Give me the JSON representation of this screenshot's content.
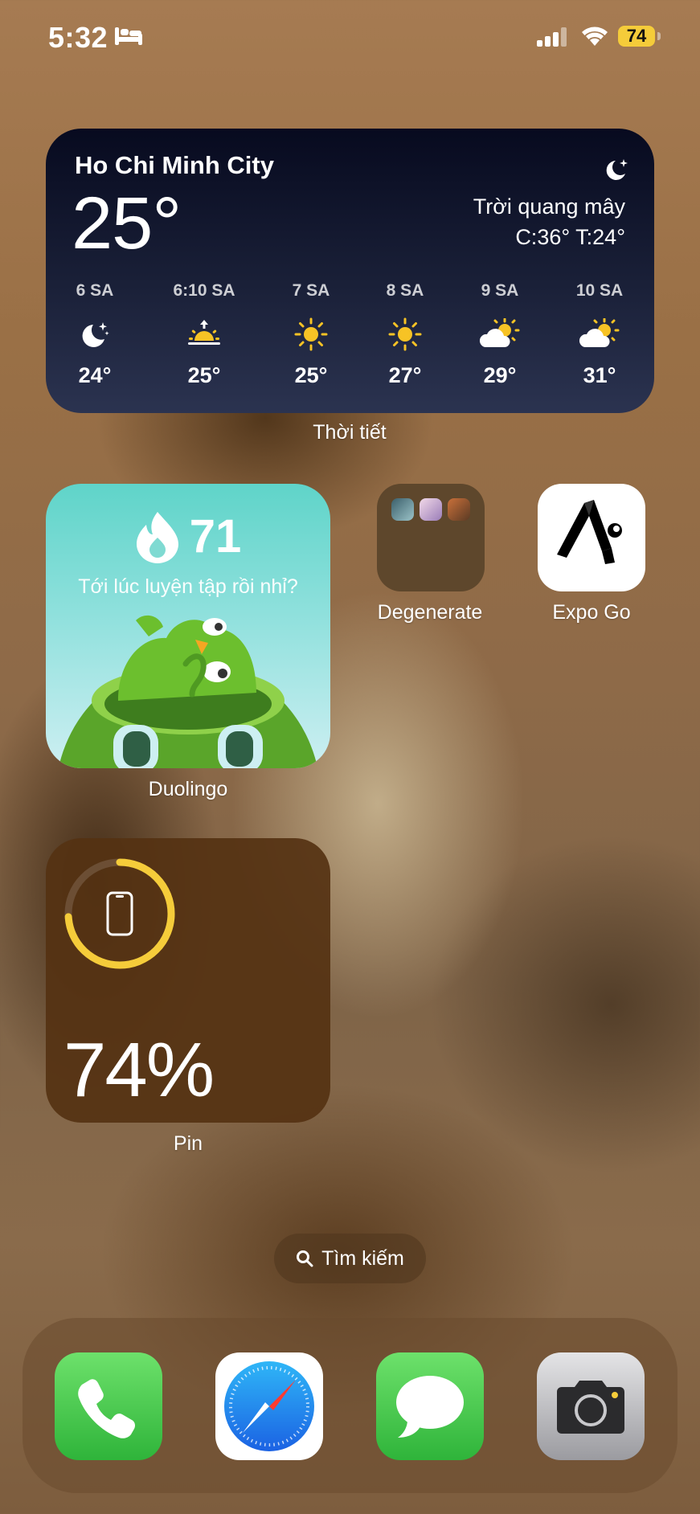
{
  "status_bar": {
    "time": "5:32",
    "battery_level": "74",
    "icons": [
      "bed-icon",
      "cellular-signal-icon",
      "wifi-icon",
      "battery-icon"
    ]
  },
  "weather_widget": {
    "city": "Ho Chi Minh City",
    "temperature": "25°",
    "condition": "Trời quang mây",
    "high_low": "C:36° T:24°",
    "condition_icon": "moon-stars-icon",
    "hours": [
      {
        "time": "6 SA",
        "icon": "moon-stars-icon",
        "temp": "24°"
      },
      {
        "time": "6:10 SA",
        "icon": "sunrise-icon",
        "temp": "25°"
      },
      {
        "time": "7 SA",
        "icon": "sun-icon",
        "temp": "25°"
      },
      {
        "time": "8 SA",
        "icon": "sun-icon",
        "temp": "27°"
      },
      {
        "time": "9 SA",
        "icon": "partly-cloudy-icon",
        "temp": "29°"
      },
      {
        "time": "10 SA",
        "icon": "partly-cloudy-icon",
        "temp": "31°"
      }
    ],
    "label": "Thời tiết"
  },
  "duolingo_widget": {
    "streak": "71",
    "message": "Tới lúc luyện tập rồi nhỉ?",
    "label": "Duolingo"
  },
  "folder": {
    "label": "Degenerate",
    "app_count_visible": 3
  },
  "expo_app": {
    "label": "Expo Go"
  },
  "battery_widget": {
    "percent": "74%",
    "level": 0.74,
    "label": "Pin",
    "accent": "#f5cc3a"
  },
  "search": {
    "label": "Tìm kiếm"
  },
  "dock": {
    "apps": [
      {
        "name": "phone-app",
        "icon": "phone-icon"
      },
      {
        "name": "safari-app",
        "icon": "compass-icon"
      },
      {
        "name": "messages-app",
        "icon": "speech-bubble-icon"
      },
      {
        "name": "camera-app",
        "icon": "camera-icon"
      }
    ]
  }
}
